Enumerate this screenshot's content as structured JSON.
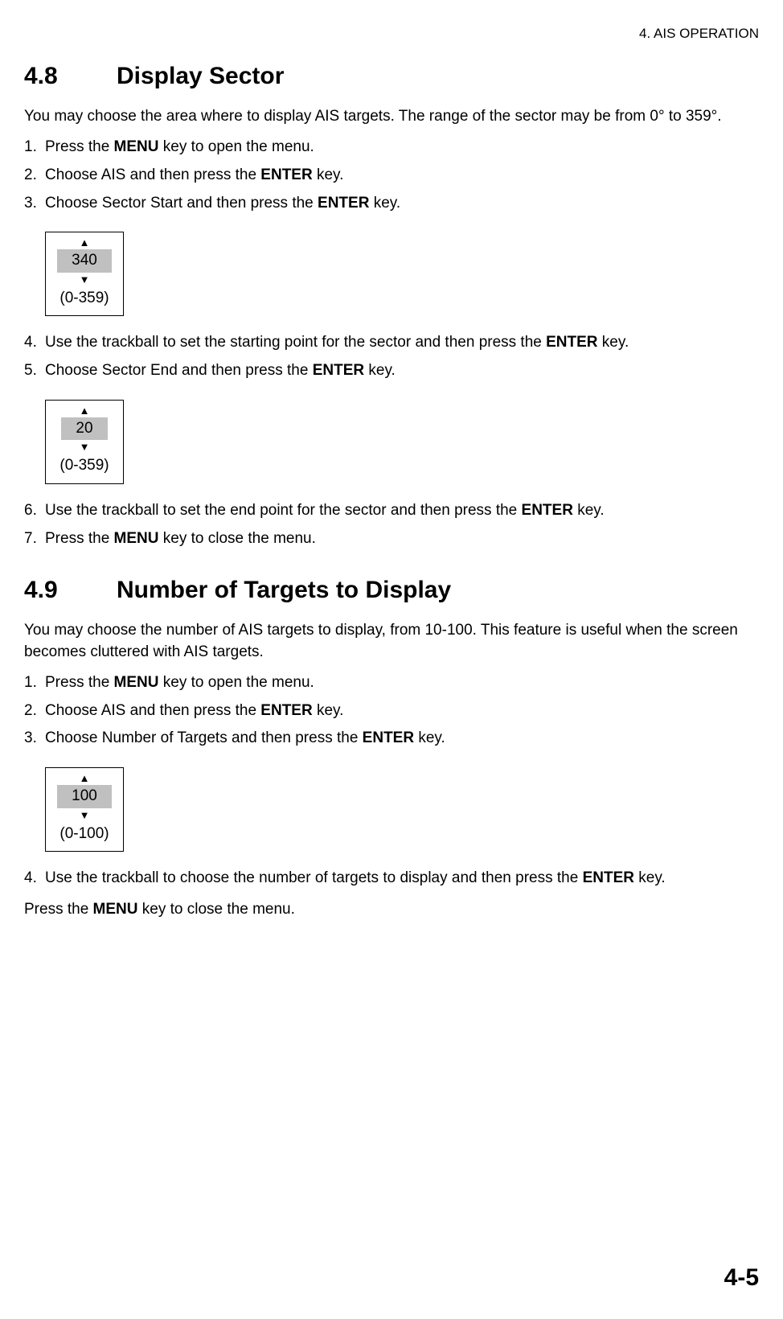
{
  "header": "4. AIS OPERATION",
  "section48": {
    "num": "4.8",
    "title": "Display Sector",
    "intro": "You may choose the area where to display AIS targets. The range of the sector may be from 0° to 359°.",
    "step1_a": "Press the ",
    "step1_b": "MENU",
    "step1_c": " key to open the menu.",
    "step2_a": "Choose AIS and then press the ",
    "step2_b": "ENTER",
    "step2_c": " key.",
    "step3_a": "Choose Sector Start and then press the ",
    "step3_b": "ENTER",
    "step3_c": " key.",
    "box1_value": "340",
    "box1_range": "(0-359)",
    "step4_a": "Use the trackball to set the starting point for the sector and then press the ",
    "step4_b": "ENTER",
    "step4_c": " key.",
    "step5_a": "Choose Sector End and then press the ",
    "step5_b": "ENTER",
    "step5_c": " key.",
    "box2_value": "20",
    "box2_range": "(0-359)",
    "step6_a": "Use the trackball to set the end point for the sector and then press the ",
    "step6_b": "ENTER",
    "step6_c": " key.",
    "step7_a": "Press the ",
    "step7_b": "MENU",
    "step7_c": " key to close the menu."
  },
  "section49": {
    "num": "4.9",
    "title": "Number of Targets to Display",
    "intro": "You may choose the number of AIS targets to display, from 10-100. This feature is useful when the screen becomes cluttered with AIS targets.",
    "step1_a": "Press the ",
    "step1_b": "MENU",
    "step1_c": " key to open the menu.",
    "step2_a": "Choose AIS and then press the ",
    "step2_b": "ENTER",
    "step2_c": " key.",
    "step3_a": "Choose Number of Targets and then press the ",
    "step3_b": "ENTER",
    "step3_c": " key.",
    "box_value": "100",
    "box_range": "(0-100)",
    "step4_a": "Use the trackball to choose the number of targets to display and then press the ",
    "step4_b": "ENTER",
    "step4_c": " key.",
    "closing_a": "Press the ",
    "closing_b": "MENU",
    "closing_c": " key to close the menu."
  },
  "pageNum": "4-5"
}
